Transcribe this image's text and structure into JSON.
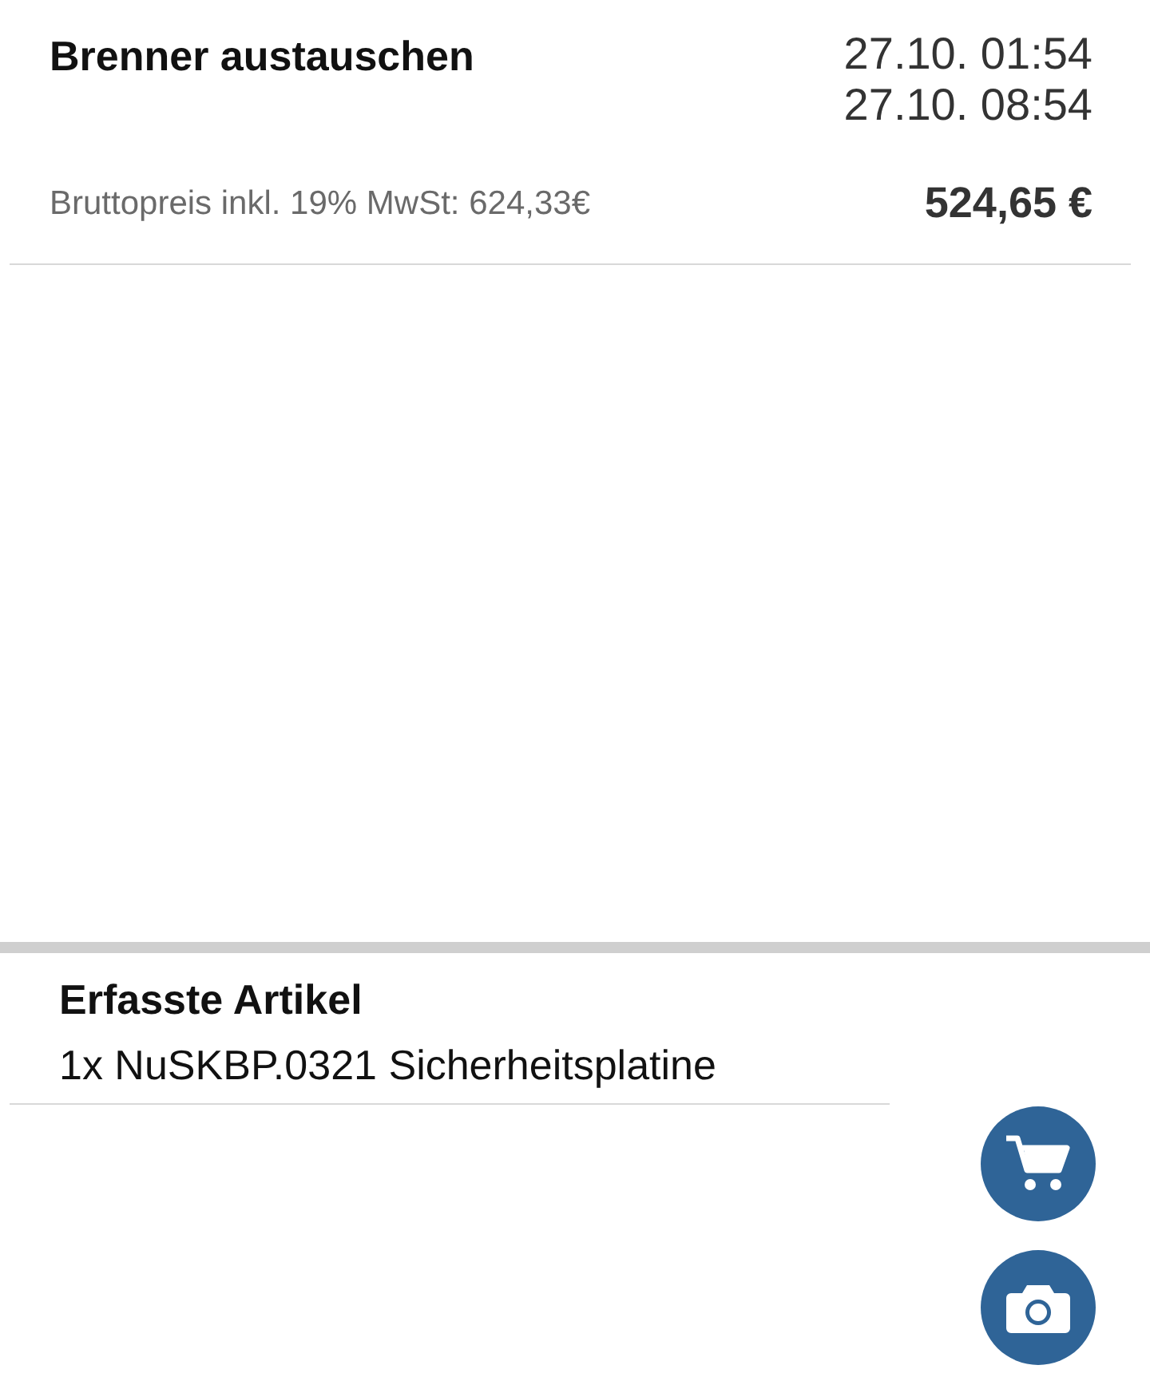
{
  "order": {
    "title": "Brenner austauschen",
    "start": "27.10. 01:54",
    "end": "27.10. 08:54",
    "gross_price": "Bruttopreis inkl. 19% MwSt: 624,33€",
    "net_price": "524,65 €"
  },
  "articles": {
    "heading": "Erfasste Artikel",
    "items": [
      "1x NuSKBP.0321 Sicherheitsplatine"
    ]
  },
  "actions": [
    {
      "kind": "cart"
    },
    {
      "kind": "camera"
    }
  ]
}
